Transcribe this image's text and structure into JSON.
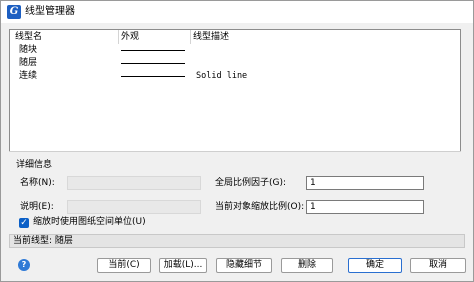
{
  "window": {
    "title": "线型管理器"
  },
  "list": {
    "columns": [
      "线型名",
      "外观",
      "线型描述"
    ],
    "rows": [
      {
        "name": "随块",
        "description": ""
      },
      {
        "name": "随层",
        "description": ""
      },
      {
        "name": "连续",
        "description": "Solid line"
      }
    ]
  },
  "details": {
    "group_label": "详细信息",
    "name_label": "名称(N):",
    "name_value": "",
    "desc_label": "说明(E):",
    "desc_value": "",
    "global_scale_label": "全局比例因子(G):",
    "global_scale_value": "1",
    "current_scale_label": "当前对象缩放比例(O):",
    "current_scale_value": "1",
    "paper_units_label": "缩放时使用图纸空间单位(U)",
    "paper_units_checked": true
  },
  "status": {
    "text": "当前线型: 随层"
  },
  "buttons": {
    "current": "当前(C)",
    "load": "加载(L)...",
    "hide_details": "隐藏细节",
    "delete": "删除",
    "ok": "确定",
    "cancel": "取消"
  },
  "colors": {
    "accent": "#0a5fc7",
    "app_icon": "#1d5fc2"
  },
  "icons": {
    "app": "app-logo-icon",
    "help": "help-icon",
    "checkbox": "checkmark-icon"
  }
}
